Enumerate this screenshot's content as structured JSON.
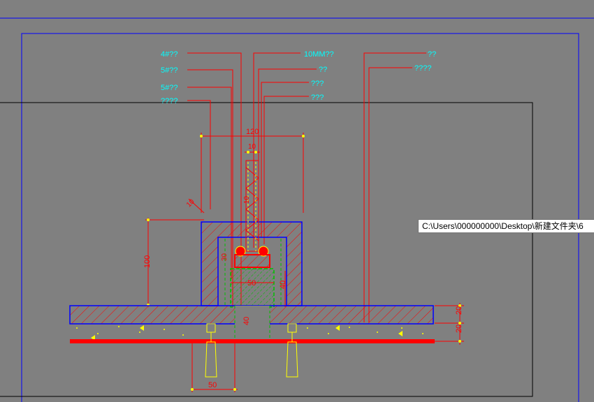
{
  "labels": {
    "callouts_left": [
      "4#??",
      "5#??",
      "5#??",
      "????"
    ],
    "callouts_right_top": [
      "10MM??",
      "??",
      "???",
      "???"
    ],
    "callouts_far_right": [
      "??",
      "????"
    ]
  },
  "dimensions": {
    "width_top": "120",
    "gap_top": "10",
    "slope": "10",
    "height_left": "100",
    "inner_left": "30",
    "inner_width": "50",
    "inner_height": "40",
    "lower_height": "40",
    "right_top": "20",
    "right_bottom": "20",
    "bottom_width": "50",
    "mid_small": "10"
  },
  "tooltip": {
    "path": "C:\\Users\\000000000\\Desktop\\新建文件夹\\6"
  },
  "colors": {
    "background": "#808080",
    "frame": "#0000ff",
    "leader": "#ff0000",
    "dimension_text": "#ff0000",
    "callout_text": "#00ffff",
    "hatch": "#ff0000",
    "concrete": "#ffff00",
    "bolt": "#ffff00",
    "green": "#00c000"
  }
}
